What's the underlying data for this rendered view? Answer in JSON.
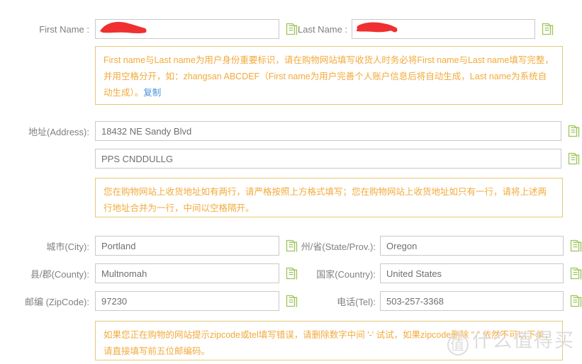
{
  "form": {
    "rows": [
      {
        "id": "first-name",
        "label": "First Name :",
        "value": "",
        "redacted": true,
        "copy_icon": "copy-document-icon"
      },
      {
        "id": "last-name",
        "label": "Last Name :",
        "value": "",
        "redacted": true,
        "copy_icon": "copy-document-icon"
      },
      {
        "id": "address-line-1",
        "label": "地址(Address):",
        "value": "18432 NE Sandy Blvd",
        "redacted": false,
        "copy_icon": "copy-document-icon"
      },
      {
        "id": "address-line-2",
        "label": "",
        "value": "PPS CNDDULLG",
        "redacted": false,
        "copy_icon": "copy-document-icon"
      },
      {
        "id": "city",
        "label": "城市(City):",
        "value": "Portland",
        "redacted": false,
        "copy_icon": "copy-document-icon"
      },
      {
        "id": "state",
        "label": "州/省(State/Prov.):",
        "value": "Oregon",
        "redacted": false,
        "copy_icon": "copy-document-icon"
      },
      {
        "id": "county",
        "label": "县/郡(County):",
        "value": "Multnomah",
        "redacted": false,
        "copy_icon": "copy-document-icon"
      },
      {
        "id": "country",
        "label": "国家(Country):",
        "value": "United States",
        "redacted": false,
        "copy_icon": "copy-document-icon"
      },
      {
        "id": "zipcode",
        "label": "邮编 (ZipCode):",
        "value": "97230",
        "redacted": false,
        "copy_icon": "copy-document-icon"
      },
      {
        "id": "tel",
        "label": "电话(Tel):",
        "value": "503-257-3368",
        "redacted": false,
        "copy_icon": "copy-document-icon"
      }
    ]
  },
  "notices": {
    "name": {
      "text": "First name与Last name为用户身份重要标识，请在购物网站填写收货人时务必将First name与Last name填写完整，并用空格分开，如：zhangsan ABCDEF（First name为用户完善个人账户信息后将自动生成，Last name为系统自动生成）。",
      "link_label": "复制"
    },
    "address": {
      "text": "您在购物网站上收货地址如有两行，请严格按照上方格式填写；您在购物网站上收货地址如只有一行，请将上述两行地址合并为一行，中间以空格隔开。"
    },
    "zip": {
      "text": "如果您正在购物的网站提示zipcode或tel填写错误，请删除数字中间 '-' 试试，如果zipcode删除 \" \" 依然不可以下单，请直接填写前五位邮编码。"
    }
  },
  "watermark": {
    "mark": "值",
    "text": "什么值得买"
  },
  "colors": {
    "notice_border": "#e3c97a",
    "notice_text": "#f2aa3c",
    "link": "#4a90d9",
    "label": "#808080",
    "field_border": "#c9c9c9",
    "field_text": "#6f6f6f",
    "copy_icon": "#8fbf4a",
    "redaction": "#f03030"
  }
}
